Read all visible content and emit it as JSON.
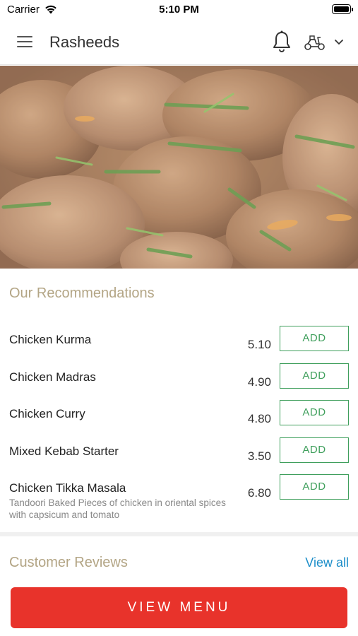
{
  "status_bar": {
    "carrier": "Carrier",
    "time": "5:10 PM",
    "wifi_icon": "wifi-icon",
    "battery_icon": "battery-icon"
  },
  "header": {
    "title": "Rasheeds",
    "menu_icon": "hamburger-menu-icon",
    "notification_icon": "bell-icon",
    "delivery_icon": "scooter-icon",
    "dropdown_icon": "chevron-down-icon"
  },
  "hero": {
    "image": "food-dish-photo"
  },
  "recommendations": {
    "title": "Our Recommendations",
    "items": [
      {
        "name": "Chicken Kurma",
        "price": "5.10",
        "button": "ADD"
      },
      {
        "name": "Chicken Madras",
        "price": "4.90",
        "button": "ADD"
      },
      {
        "name": "Chicken Curry",
        "price": "4.80",
        "button": "ADD"
      },
      {
        "name": "Mixed Kebab Starter",
        "price": "3.50",
        "button": "ADD"
      },
      {
        "name": "Chicken Tikka Masala",
        "description": "Tandoori Baked Pieces of chicken in oriental spices with capsicum and tomato",
        "price": "6.80",
        "button": "ADD"
      }
    ]
  },
  "reviews": {
    "title": "Customer Reviews",
    "view_all": "View all"
  },
  "footer": {
    "view_menu_label": "VIEW MENU"
  },
  "colors": {
    "accent_red": "#e8332b",
    "add_green": "#3f9f5c",
    "section_title": "#b3a585",
    "link_blue": "#1f8fc9"
  }
}
